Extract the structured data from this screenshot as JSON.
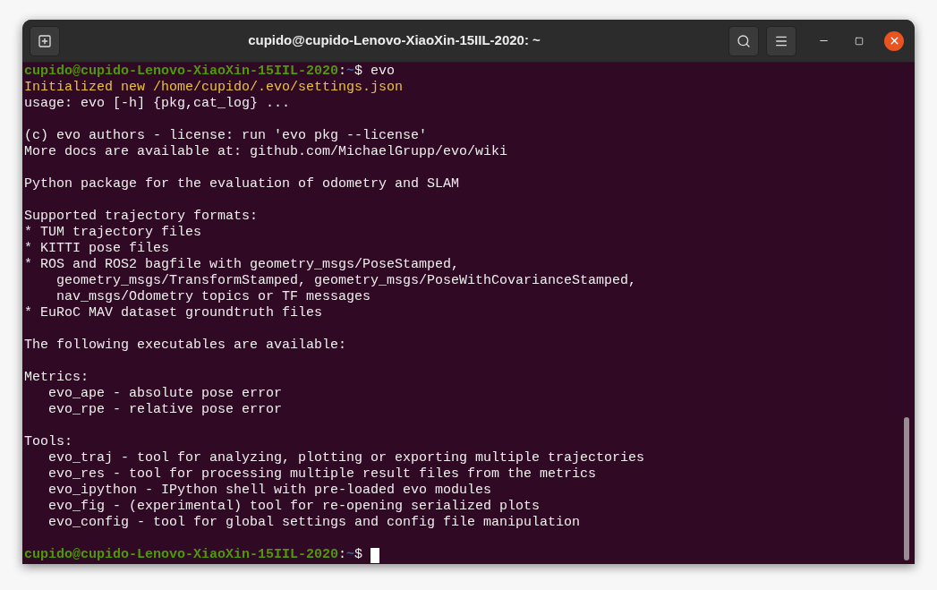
{
  "window": {
    "title": "cupido@cupido-Lenovo-XiaoXin-15IIL-2020: ~"
  },
  "terminal": {
    "lines": [
      {
        "kind": "prompt",
        "user_host": "cupido@cupido-Lenovo-XiaoXin-15IIL-2020",
        "separator": ":",
        "path": "~",
        "symbol": "$",
        "command": " evo"
      },
      {
        "kind": "warning",
        "text": "Initialized new /home/cupido/.evo/settings.json"
      },
      {
        "kind": "output",
        "text": "usage: evo [-h] {pkg,cat_log} ..."
      },
      {
        "kind": "blank"
      },
      {
        "kind": "output",
        "text": "(c) evo authors - license: run 'evo pkg --license'"
      },
      {
        "kind": "output",
        "text": "More docs are available at: github.com/MichaelGrupp/evo/wiki"
      },
      {
        "kind": "blank"
      },
      {
        "kind": "output",
        "text": "Python package for the evaluation of odometry and SLAM"
      },
      {
        "kind": "blank"
      },
      {
        "kind": "output",
        "text": "Supported trajectory formats:"
      },
      {
        "kind": "output",
        "text": "* TUM trajectory files"
      },
      {
        "kind": "output",
        "text": "* KITTI pose files"
      },
      {
        "kind": "output",
        "text": "* ROS and ROS2 bagfile with geometry_msgs/PoseStamped,"
      },
      {
        "kind": "output",
        "text": "    geometry_msgs/TransformStamped, geometry_msgs/PoseWithCovarianceStamped,"
      },
      {
        "kind": "output",
        "text": "    nav_msgs/Odometry topics or TF messages"
      },
      {
        "kind": "output",
        "text": "* EuRoC MAV dataset groundtruth files"
      },
      {
        "kind": "blank"
      },
      {
        "kind": "output",
        "text": "The following executables are available:"
      },
      {
        "kind": "blank"
      },
      {
        "kind": "output",
        "text": "Metrics:"
      },
      {
        "kind": "output",
        "text": "   evo_ape - absolute pose error"
      },
      {
        "kind": "output",
        "text": "   evo_rpe - relative pose error"
      },
      {
        "kind": "blank"
      },
      {
        "kind": "output",
        "text": "Tools:"
      },
      {
        "kind": "output",
        "text": "   evo_traj - tool for analyzing, plotting or exporting multiple trajectories"
      },
      {
        "kind": "output",
        "text": "   evo_res - tool for processing multiple result files from the metrics"
      },
      {
        "kind": "output",
        "text": "   evo_ipython - IPython shell with pre-loaded evo modules"
      },
      {
        "kind": "output",
        "text": "   evo_fig - (experimental) tool for re-opening serialized plots"
      },
      {
        "kind": "output",
        "text": "   evo_config - tool for global settings and config file manipulation"
      },
      {
        "kind": "blank"
      },
      {
        "kind": "prompt",
        "user_host": "cupido@cupido-Lenovo-XiaoXin-15IIL-2020",
        "separator": ":",
        "path": "~",
        "symbol": "$",
        "cursor": true
      }
    ]
  }
}
